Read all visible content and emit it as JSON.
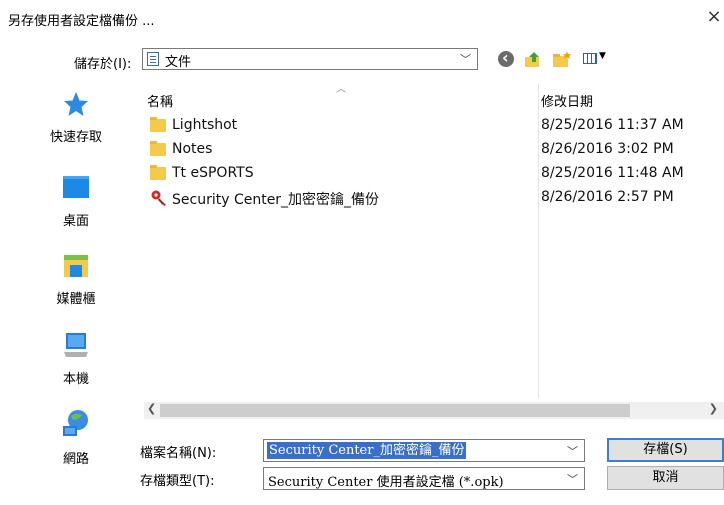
{
  "window": {
    "title": "另存使用者設定檔備份 ...",
    "close_glyph": "×"
  },
  "save_in": {
    "label": "儲存於(I):",
    "value": "文件"
  },
  "sidebar": {
    "items": [
      {
        "label": "快速存取",
        "icon": "star-icon"
      },
      {
        "label": "桌面",
        "icon": "desktop-icon"
      },
      {
        "label": "媒體櫃",
        "icon": "library-icon"
      },
      {
        "label": "本機",
        "icon": "computer-icon"
      },
      {
        "label": "網路",
        "icon": "network-icon"
      }
    ]
  },
  "columns": {
    "name": "名稱",
    "modified": "修改日期"
  },
  "files": [
    {
      "name": "Lightshot",
      "modified": "8/25/2016 11:37 AM",
      "type": "folder"
    },
    {
      "name": "Notes",
      "modified": "8/26/2016 3:02 PM",
      "type": "folder"
    },
    {
      "name": "Tt eSPORTS",
      "modified": "8/25/2016 11:48 AM",
      "type": "folder"
    },
    {
      "name": "Security Center_加密密鑰_備份",
      "modified": "8/26/2016 2:57 PM",
      "type": "key-file"
    }
  ],
  "filename": {
    "label": "檔案名稱(N):",
    "value": "Security Center_加密密鑰_備份"
  },
  "filetype": {
    "label": "存檔類型(T):",
    "value": "Security Center 使用者設定檔 (*.opk)"
  },
  "buttons": {
    "save": "存檔(S)",
    "cancel": "取消"
  },
  "colors": {
    "selection": "#3a6fc9",
    "primary_border": "#3c7fcf",
    "folder": "#f5c94a"
  }
}
